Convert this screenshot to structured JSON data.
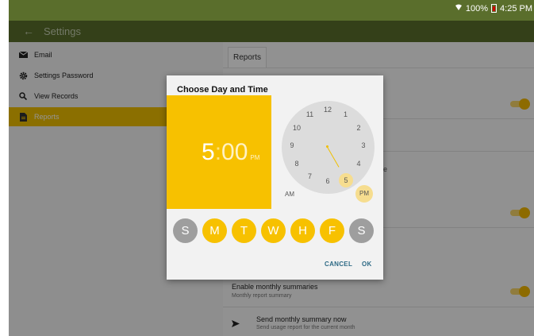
{
  "status_bar": {
    "battery": "100%",
    "time": "4:25 PM"
  },
  "app_bar": {
    "back_icon": "←",
    "title": "Settings"
  },
  "nav": {
    "items": [
      {
        "label": "Email",
        "icon": "envelope-icon"
      },
      {
        "label": "Settings Password",
        "icon": "gear-icon"
      },
      {
        "label": "View Records",
        "icon": "search-icon"
      },
      {
        "label": "Reports",
        "icon": "report-icon",
        "active": true
      }
    ]
  },
  "right_panel": {
    "tab": "Reports",
    "monthly": {
      "title": "Enable monthly summaries",
      "subtitle": "Monthly report summary"
    },
    "send": {
      "title": "Send monthly summary now",
      "subtitle": "Send usage report for the current month"
    }
  },
  "dialog": {
    "title": "Choose Day and Time",
    "time": {
      "hour": "5",
      "separator": ":",
      "minutes": "00",
      "ampm": "PM"
    },
    "clock_numbers": [
      "12",
      "1",
      "2",
      "3",
      "4",
      "5",
      "6",
      "7",
      "8",
      "9",
      "10",
      "11"
    ],
    "selected_hour": "5",
    "am_label": "AM",
    "pm_label": "PM",
    "days": [
      {
        "label": "S",
        "selected": false
      },
      {
        "label": "M",
        "selected": true
      },
      {
        "label": "T",
        "selected": true
      },
      {
        "label": "W",
        "selected": true
      },
      {
        "label": "H",
        "selected": true
      },
      {
        "label": "F",
        "selected": true
      },
      {
        "label": "S",
        "selected": false
      }
    ],
    "cancel": "CANCEL",
    "ok": "OK"
  },
  "colors": {
    "appbar": "#5a6e2c",
    "accent": "#f7c100",
    "button_text": "#2f6b86"
  }
}
